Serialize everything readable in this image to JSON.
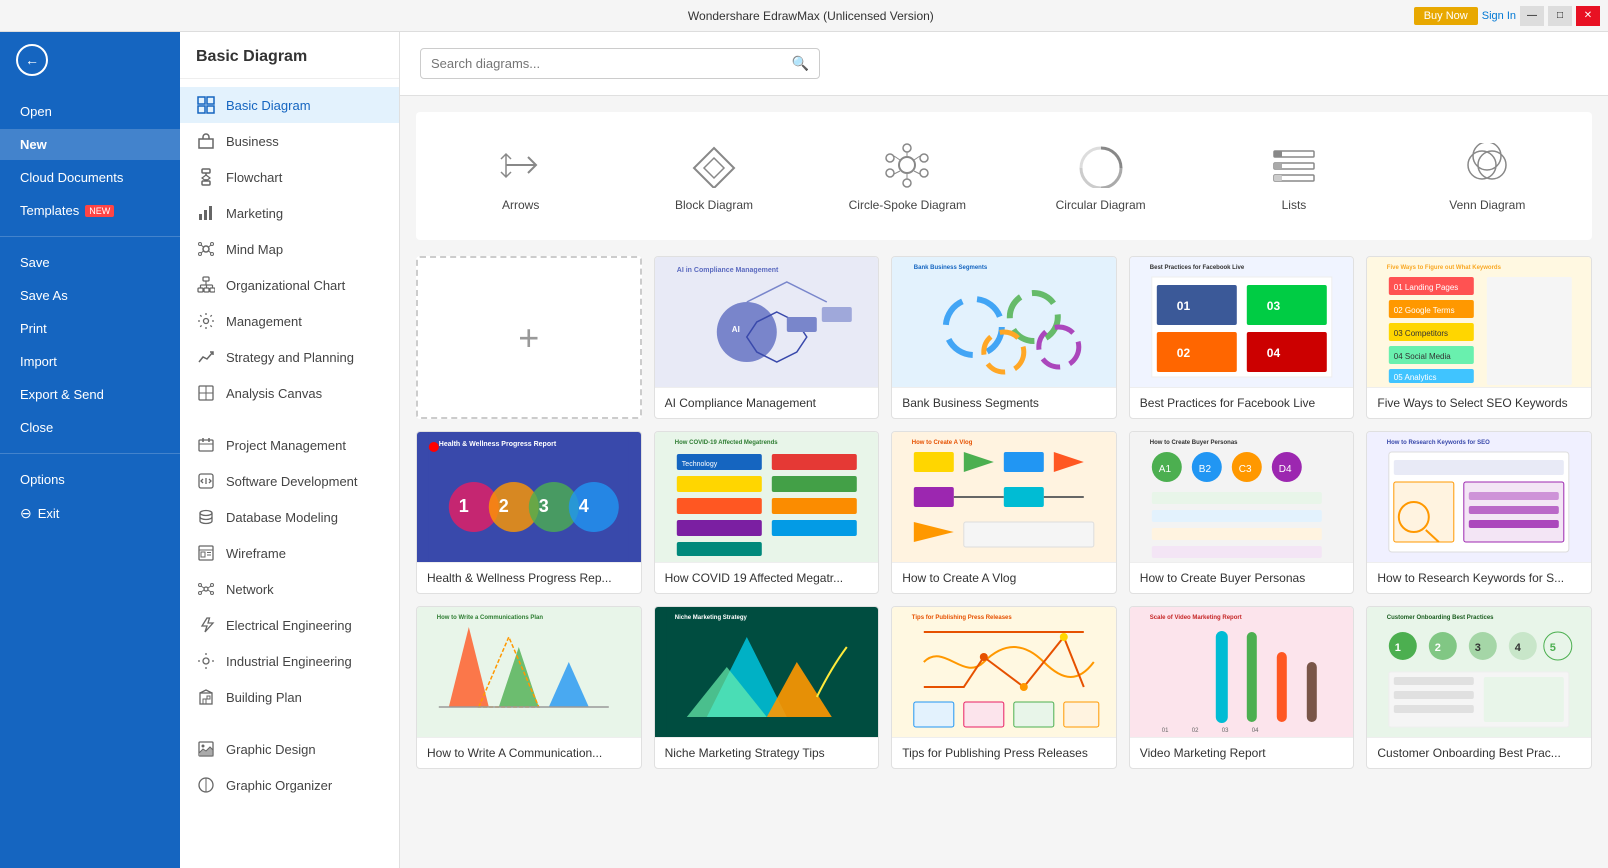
{
  "titlebar": {
    "title": "Wondershare EdrawMax (Unlicensed Version)",
    "minimize": "—",
    "maximize": "□",
    "close": "✕",
    "buy_now": "Buy Now",
    "sign_in": "Sign In"
  },
  "sidebar": {
    "back_label": "←",
    "items": [
      {
        "id": "open",
        "label": "Open",
        "active": false
      },
      {
        "id": "new",
        "label": "New",
        "active": true
      },
      {
        "id": "cloud",
        "label": "Cloud Documents",
        "active": false
      },
      {
        "id": "templates",
        "label": "Templates",
        "badge": "NEW",
        "active": false
      },
      {
        "id": "save",
        "label": "Save",
        "active": false
      },
      {
        "id": "saveas",
        "label": "Save As",
        "active": false
      },
      {
        "id": "print",
        "label": "Print",
        "active": false
      },
      {
        "id": "import",
        "label": "Import",
        "active": false
      },
      {
        "id": "export",
        "label": "Export & Send",
        "active": false
      },
      {
        "id": "close",
        "label": "Close",
        "active": false
      },
      {
        "id": "options",
        "label": "Options",
        "active": false
      },
      {
        "id": "exit",
        "label": "Exit",
        "active": false
      }
    ]
  },
  "category_panel": {
    "title": "Basic Diagram",
    "categories": [
      {
        "id": "basic",
        "label": "Basic Diagram",
        "active": true,
        "icon": "grid"
      },
      {
        "id": "business",
        "label": "Business",
        "active": false,
        "icon": "briefcase"
      },
      {
        "id": "flowchart",
        "label": "Flowchart",
        "active": false,
        "icon": "flow"
      },
      {
        "id": "marketing",
        "label": "Marketing",
        "active": false,
        "icon": "chart-bar"
      },
      {
        "id": "mindmap",
        "label": "Mind Map",
        "active": false,
        "icon": "mindmap"
      },
      {
        "id": "orgchart",
        "label": "Organizational Chart",
        "active": false,
        "icon": "org"
      },
      {
        "id": "management",
        "label": "Management",
        "active": false,
        "icon": "gear"
      },
      {
        "id": "strategy",
        "label": "Strategy and Planning",
        "active": false,
        "icon": "strategy"
      },
      {
        "id": "analysis",
        "label": "Analysis Canvas",
        "active": false,
        "icon": "analysis"
      },
      {
        "id": "project",
        "label": "Project Management",
        "active": false,
        "icon": "project"
      },
      {
        "id": "software",
        "label": "Software Development",
        "active": false,
        "icon": "software"
      },
      {
        "id": "database",
        "label": "Database Modeling",
        "active": false,
        "icon": "database"
      },
      {
        "id": "wireframe",
        "label": "Wireframe",
        "active": false,
        "icon": "wireframe"
      },
      {
        "id": "network",
        "label": "Network",
        "active": false,
        "icon": "network"
      },
      {
        "id": "electrical",
        "label": "Electrical Engineering",
        "active": false,
        "icon": "electrical"
      },
      {
        "id": "industrial",
        "label": "Industrial Engineering",
        "active": false,
        "icon": "industrial"
      },
      {
        "id": "building",
        "label": "Building Plan",
        "active": false,
        "icon": "building"
      },
      {
        "id": "graphic",
        "label": "Graphic Design",
        "active": false,
        "icon": "graphic"
      },
      {
        "id": "organizer",
        "label": "Graphic Organizer",
        "active": false,
        "icon": "organizer"
      }
    ]
  },
  "search": {
    "placeholder": "Search diagrams...",
    "value": ""
  },
  "shapes": [
    {
      "id": "arrows",
      "label": "Arrows",
      "icon": "arrows"
    },
    {
      "id": "block",
      "label": "Block Diagram",
      "icon": "block"
    },
    {
      "id": "circle-spoke",
      "label": "Circle-Spoke Diagram",
      "icon": "circle-spoke"
    },
    {
      "id": "circular",
      "label": "Circular Diagram",
      "icon": "circular"
    },
    {
      "id": "lists",
      "label": "Lists",
      "icon": "lists"
    },
    {
      "id": "venn",
      "label": "Venn Diagram",
      "icon": "venn"
    }
  ],
  "templates": [
    {
      "id": "new",
      "type": "new",
      "label": ""
    },
    {
      "id": "ai-compliance",
      "label": "AI Compliance Management",
      "color": "#e8eaf6",
      "accent": "#5c6bc0"
    },
    {
      "id": "bank-business",
      "label": "Bank Business Segments",
      "color": "#e3f2fd",
      "accent": "#1e88e5"
    },
    {
      "id": "facebook-live",
      "label": "Best Practices for Facebook Live",
      "color": "#fce4ec",
      "accent": "#e91e63"
    },
    {
      "id": "seo-keywords",
      "label": "Five Ways to Select SEO Keywords",
      "color": "#fff8e1",
      "accent": "#f9a825"
    },
    {
      "id": "health-wellness",
      "label": "Health & Wellness Progress Rep...",
      "color": "#3949ab",
      "accent": "#ffffff"
    },
    {
      "id": "covid",
      "label": "How COVID 19 Affected Megatr...",
      "color": "#e8f5e9",
      "accent": "#43a047"
    },
    {
      "id": "vlog",
      "label": "How to Create A Vlog",
      "color": "#efebe9",
      "accent": "#795548"
    },
    {
      "id": "buyer-personas",
      "label": "How to Create Buyer Personas",
      "color": "#f3e5f5",
      "accent": "#8e24aa"
    },
    {
      "id": "research-keywords",
      "label": "How to Research Keywords for S...",
      "color": "#e8eaf6",
      "accent": "#3949ab"
    },
    {
      "id": "communications",
      "label": "How to Write A Communication...",
      "color": "#e8f5e9",
      "accent": "#2e7d32"
    },
    {
      "id": "niche-marketing",
      "label": "Niche Marketing Strategy Tips",
      "color": "#e0f7fa",
      "accent": "#00838f"
    },
    {
      "id": "press-releases",
      "label": "Tips for Publishing Press Releases",
      "color": "#fff3e0",
      "accent": "#e65100"
    },
    {
      "id": "video-marketing",
      "label": "Video Marketing Report",
      "color": "#fce4ec",
      "accent": "#c62828"
    },
    {
      "id": "customer-onboarding",
      "label": "Customer Onboarding Best Prac...",
      "color": "#e8f5e9",
      "accent": "#1b5e20"
    }
  ]
}
